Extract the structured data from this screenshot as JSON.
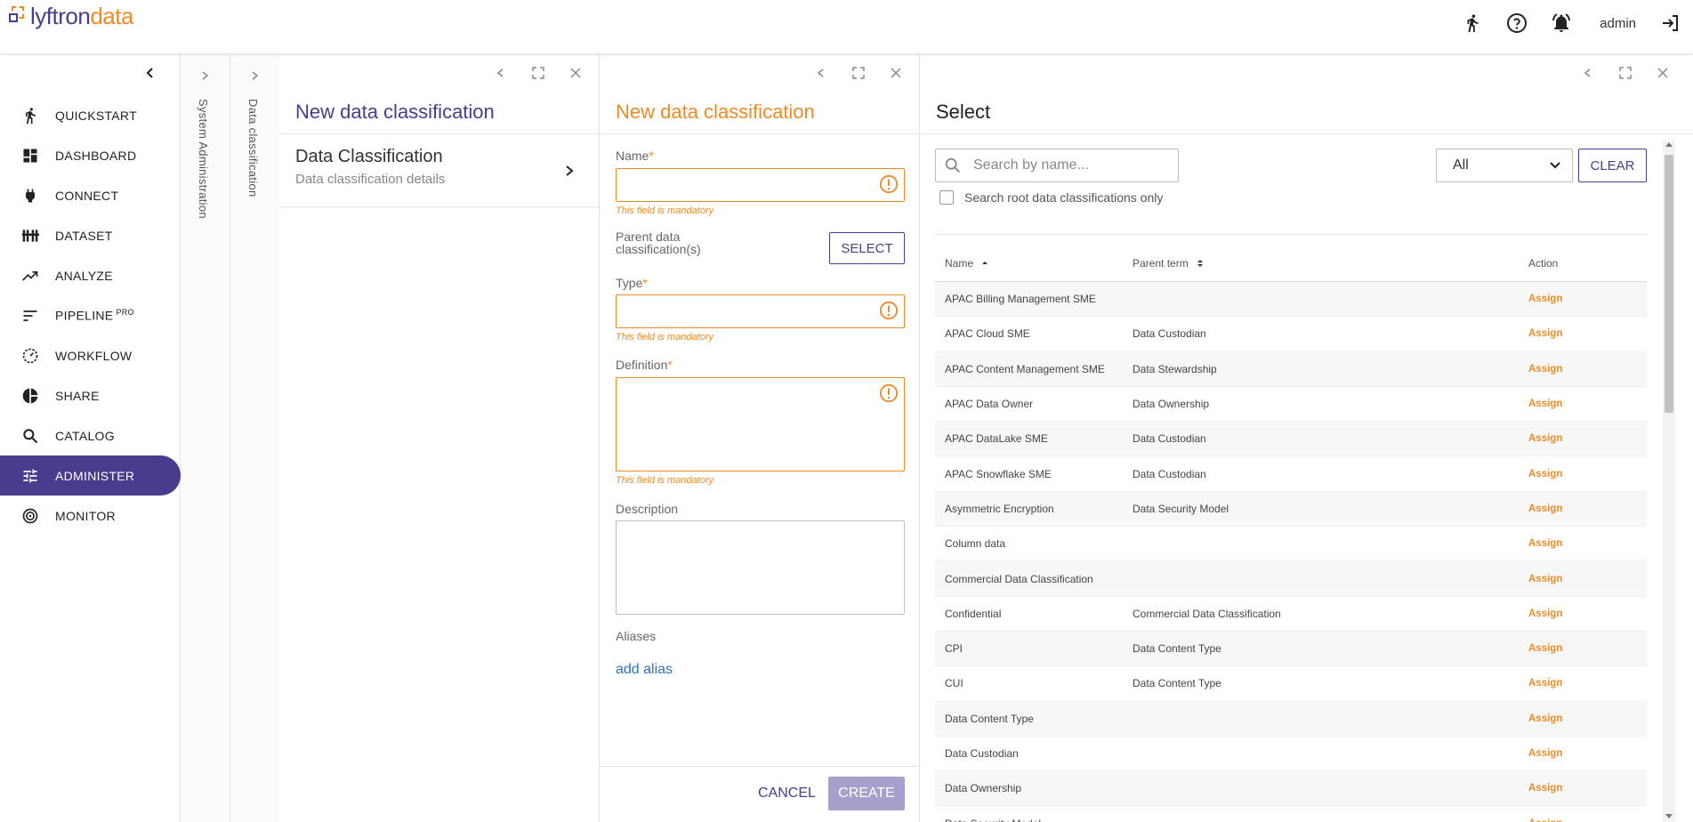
{
  "brand": {
    "part1": "lyftron",
    "part2": "data"
  },
  "topbar": {
    "user": "admin"
  },
  "sidebar": {
    "items": [
      {
        "label": "QUICKSTART",
        "icon": "running-icon"
      },
      {
        "label": "DASHBOARD",
        "icon": "dashboard-icon"
      },
      {
        "label": "CONNECT",
        "icon": "plug-icon"
      },
      {
        "label": "DATASET",
        "icon": "dataset-icon"
      },
      {
        "label": "ANALYZE",
        "icon": "trending-icon"
      },
      {
        "label": "PIPELINE",
        "sup": "PRO",
        "icon": "sort-icon"
      },
      {
        "label": "WORKFLOW",
        "icon": "speed-icon"
      },
      {
        "label": "SHARE",
        "icon": "pie-icon"
      },
      {
        "label": "CATALOG",
        "icon": "search-icon"
      },
      {
        "label": "ADMINISTER",
        "icon": "tune-icon",
        "active": true
      },
      {
        "label": "MONITOR",
        "icon": "radar-icon"
      }
    ]
  },
  "vpanels": {
    "p1": "System Administration",
    "p2": "Data classification"
  },
  "menu_panel": {
    "title": "New data classification",
    "entry_title": "Data Classification",
    "entry_subtitle": "Data classification details"
  },
  "form_panel": {
    "title": "New data classification",
    "name_label": "Name",
    "parent_label_1": "Parent data",
    "parent_label_2": "classification(s)",
    "select_label": "SELECT",
    "type_label": "Type",
    "definition_label": "Definition",
    "description_label": "Description",
    "aliases_label": "Aliases",
    "add_alias": "add alias",
    "mandatory": "This field is mandatory",
    "required_mark": "*",
    "cancel": "CANCEL",
    "create": "CREATE"
  },
  "select_panel": {
    "title": "Select",
    "search_placeholder": "Search by name...",
    "root_only": "Search root data classifications only",
    "filter_value": "All",
    "clear": "CLEAR",
    "col_name": "Name",
    "col_parent": "Parent term",
    "col_action": "Action",
    "action_label": "Assign",
    "rows": [
      {
        "name": "APAC Billing Management SME",
        "parent": ""
      },
      {
        "name": "APAC Cloud SME",
        "parent": "Data Custodian"
      },
      {
        "name": "APAC Content Management SME",
        "parent": "Data Stewardship"
      },
      {
        "name": "APAC Data Owner",
        "parent": "Data Ownership"
      },
      {
        "name": "APAC DataLake SME",
        "parent": "Data Custodian"
      },
      {
        "name": "APAC Snowflake SME",
        "parent": "Data Custodian"
      },
      {
        "name": "Asymmetric Encryption",
        "parent": "Data Security Model"
      },
      {
        "name": "Column data",
        "parent": ""
      },
      {
        "name": "Commercial Data Classification",
        "parent": ""
      },
      {
        "name": "Confidential",
        "parent": "Commercial Data Classification"
      },
      {
        "name": "CPI",
        "parent": "Data Content Type"
      },
      {
        "name": "CUI",
        "parent": "Data Content Type"
      },
      {
        "name": "Data Content Type",
        "parent": ""
      },
      {
        "name": "Data Custodian",
        "parent": ""
      },
      {
        "name": "Data Ownership",
        "parent": ""
      },
      {
        "name": "Data Security Model",
        "parent": ""
      }
    ]
  },
  "colors": {
    "accent": "#4b3b8f",
    "orange": "#f08a24"
  }
}
